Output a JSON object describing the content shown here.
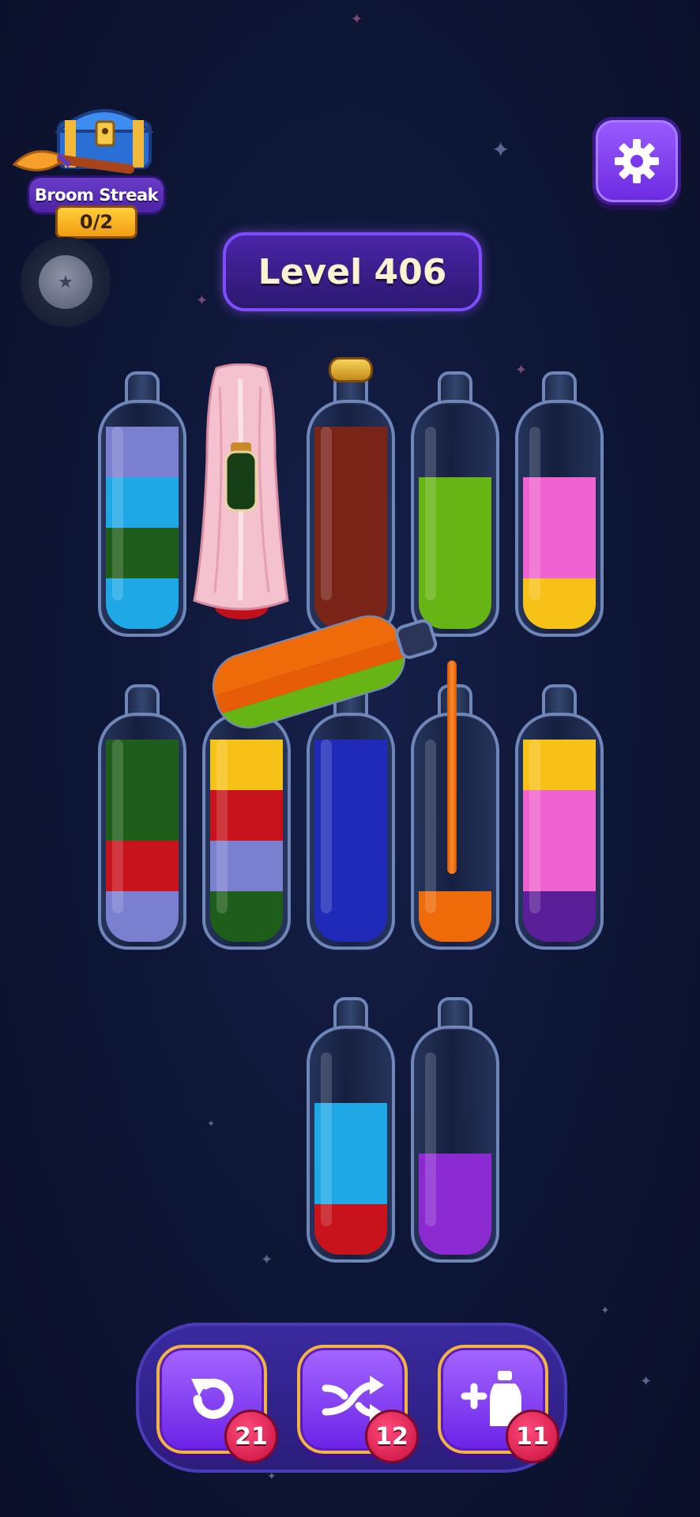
{
  "streak": {
    "title": "Broom Streak",
    "count": "0/2"
  },
  "level": {
    "label": "Level 406"
  },
  "icons": {
    "settings": "gear-icon",
    "undo": "undo-arrow-icon",
    "shuffle": "shuffle-arrows-icon",
    "add_bottle": "add-bottle-icon"
  },
  "boosters": {
    "undo_count": "21",
    "shuffle_count": "12",
    "add_bottle_count": "11"
  },
  "colors": {
    "lavender": "#7b7fd0",
    "sky_blue": "#1fa8e6",
    "dark_green": "#1f5e1a",
    "brown": "#7a2418",
    "lime": "#66b514",
    "pink": "#f062cf",
    "yellow": "#f7c217",
    "red": "#c8121c",
    "blue": "#1f2bb8",
    "orange": "#ef6a09",
    "purple": "#5a1f98",
    "violet": "#8b2ad0"
  },
  "bottles": [
    {
      "id": "r1c1",
      "layers": [
        "sky_blue",
        "dark_green",
        "sky_blue",
        "lavender"
      ]
    },
    {
      "id": "r1c2",
      "hidden": true,
      "visible_hint": "dark_green"
    },
    {
      "id": "r1c3",
      "corked": true,
      "layers": [
        "brown",
        "brown",
        "brown",
        "brown"
      ]
    },
    {
      "id": "r1c4",
      "layers": [
        "lime",
        "lime",
        "lime"
      ]
    },
    {
      "id": "r1c5",
      "layers": [
        "yellow",
        "pink",
        "pink"
      ]
    },
    {
      "id": "r2c1",
      "layers": [
        "lavender",
        "red",
        "dark_green",
        "dark_green"
      ]
    },
    {
      "id": "r2c2",
      "layers": [
        "dark_green",
        "lavender",
        "red",
        "yellow"
      ]
    },
    {
      "id": "r2c3",
      "layers": [
        "blue",
        "blue",
        "blue",
        "blue"
      ]
    },
    {
      "id": "r2c4",
      "layers": [
        "orange"
      ]
    },
    {
      "id": "r2c5",
      "layers": [
        "purple",
        "pink",
        "pink",
        "yellow"
      ]
    },
    {
      "id": "r3c1",
      "layers": [
        "red",
        "sky_blue",
        "sky_blue"
      ]
    },
    {
      "id": "r3c2",
      "layers": [
        "violet",
        "violet"
      ]
    }
  ],
  "pouring": {
    "layers": [
      "lime",
      "orange",
      "orange"
    ]
  }
}
